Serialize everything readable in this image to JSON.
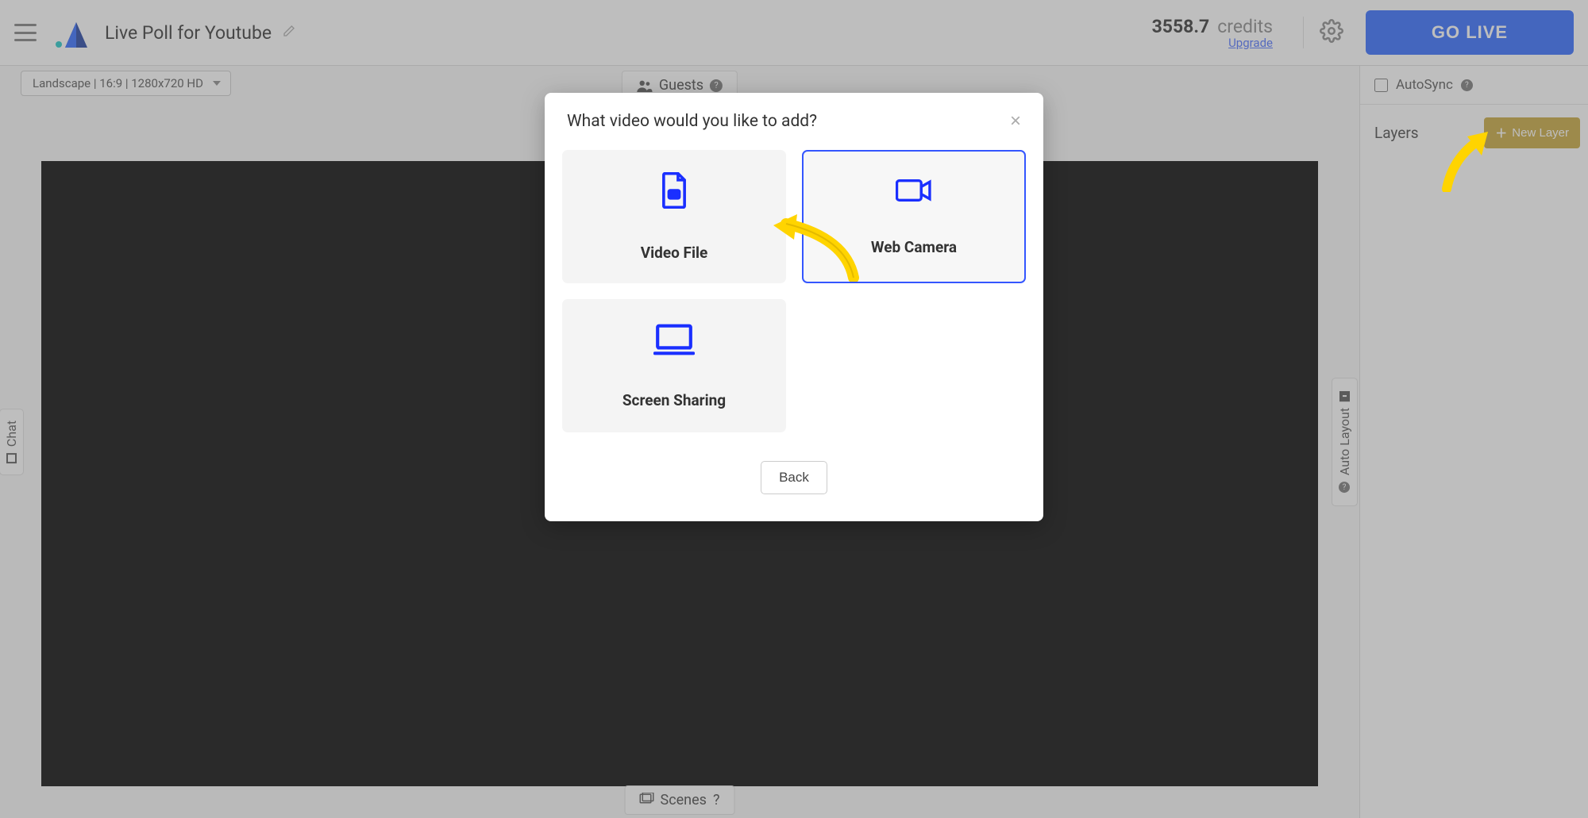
{
  "header": {
    "title": "Live Poll for Youtube",
    "credits_value": "3558.7",
    "credits_label": "credits",
    "upgrade_label": "Upgrade",
    "go_live_label": "GO LIVE"
  },
  "stage": {
    "format_label": "Landscape | 16:9 | 1280x720 HD",
    "guests_label": "Guests",
    "scenes_label": "Scenes",
    "chat_label": "Chat",
    "auto_layout_label": "Auto Layout"
  },
  "sidebar": {
    "autosync_label": "AutoSync",
    "layers_label": "Layers",
    "new_layer_label": "New Layer"
  },
  "modal": {
    "title": "What video would you like to add?",
    "options": [
      {
        "label": "Video File",
        "icon": "video-file-icon",
        "selected": false
      },
      {
        "label": "Web Camera",
        "icon": "web-camera-icon",
        "selected": true
      },
      {
        "label": "Screen Sharing",
        "icon": "screen-sharing-icon",
        "selected": false
      }
    ],
    "back_label": "Back"
  },
  "colors": {
    "primary": "#2e68ff",
    "accent_yellow": "#ffd400",
    "gold_button": "#c7a53a",
    "icon_blue": "#1a2fff"
  }
}
